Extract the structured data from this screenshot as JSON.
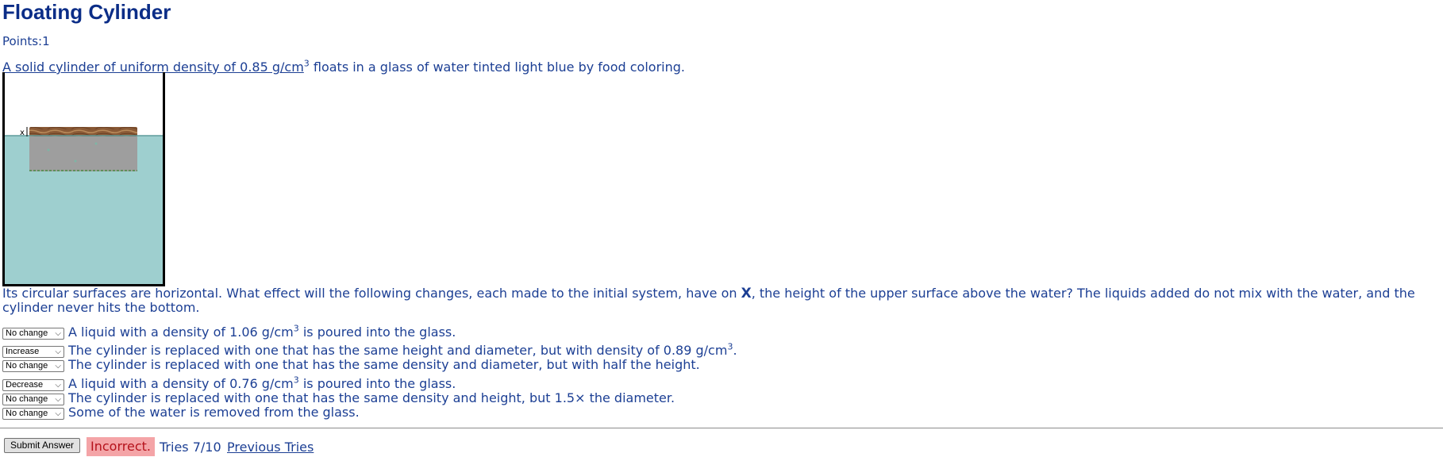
{
  "title": "Floating Cylinder",
  "points": "Points:1",
  "intro": {
    "part1": "A solid cylinder of uniform density of 0.85 g/cm",
    "sup": "3",
    "part2": " floats in a glass of water tinted light blue by food coloring."
  },
  "figure": {
    "marker": "x"
  },
  "question": {
    "part1": "Its circular surfaces are horizontal. What effect will the following changes, each made to the initial system, have on ",
    "var": "X",
    "part2": ", the height of the upper surface above the water? The liquids added do not mix with the water, and the cylinder never hits the bottom."
  },
  "items": [
    {
      "answer": "No change",
      "text1": "A liquid with a density of 1.06 g/cm",
      "sup": "3",
      "text2": " is poured into the glass."
    },
    {
      "answer": "Increase",
      "text1": "The cylinder is replaced with one that has the same height and diameter, but with density of 0.89 g/cm",
      "sup": "3",
      "text2": "."
    },
    {
      "answer": "No change",
      "text1": "The cylinder is replaced with one that has the same density and diameter, but with half the height.",
      "sup": "",
      "text2": ""
    },
    {
      "answer": "Decrease",
      "text1": "A liquid with a density of 0.76 g/cm",
      "sup": "3",
      "text2": " is poured into the glass."
    },
    {
      "answer": "No change",
      "text1": "The cylinder is replaced with one that has the same density and height, but 1.5× the diameter.",
      "sup": "",
      "text2": ""
    },
    {
      "answer": "No change",
      "text1": "Some of the water is removed from the glass.",
      "sup": "",
      "text2": ""
    }
  ],
  "footer": {
    "submit_label": "Submit Answer",
    "status": "Incorrect.",
    "tries": "Tries 7/10",
    "previous_tries": "Previous Tries"
  },
  "colors": {
    "text": "#1c3f94",
    "title": "#0b2d87",
    "water": "#9ecfcf",
    "incorrect_bg": "#f4a4a7",
    "incorrect_text": "#b5121b"
  }
}
